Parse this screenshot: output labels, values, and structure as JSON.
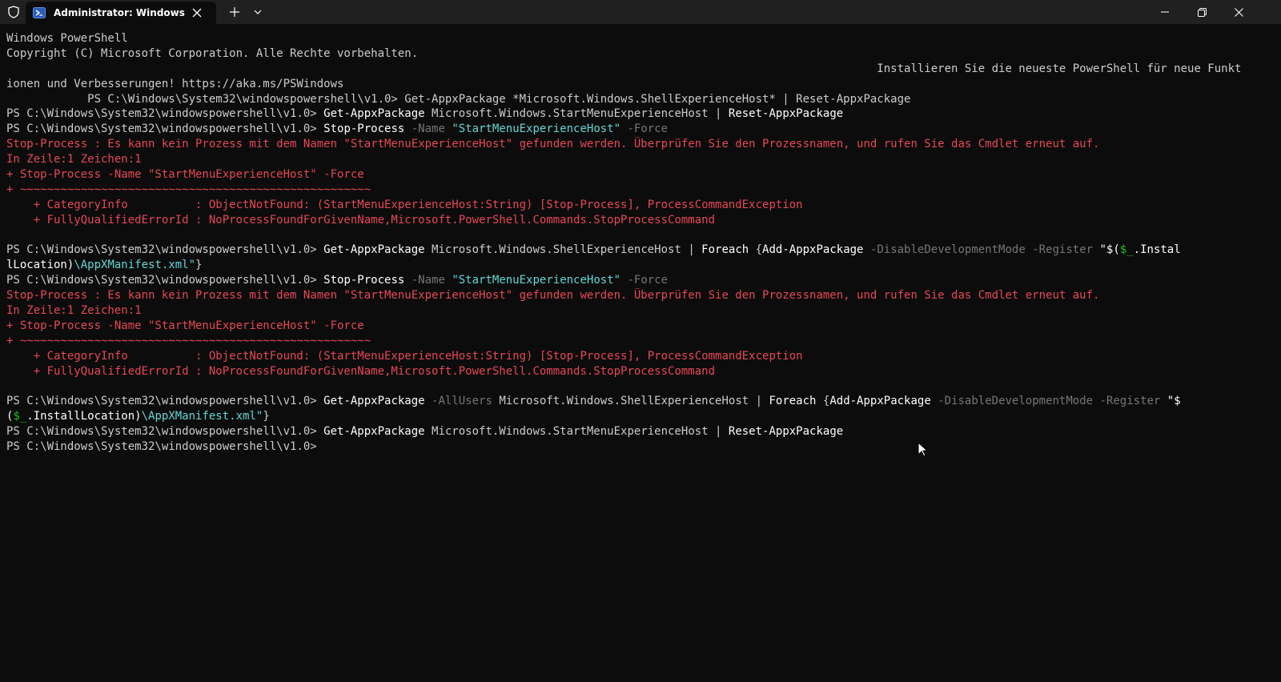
{
  "window": {
    "tab_title": "Administrator: Windows PowerShell",
    "icons": {
      "shield": "shield-icon",
      "tab": "powershell-icon",
      "close": "close-icon",
      "new_tab": "plus-icon",
      "dropdown": "chevron-down-icon",
      "minimize": "minimize-icon",
      "maximize": "restore-icon",
      "close_window": "close-icon"
    }
  },
  "colors": {
    "background": "#0c0c0c",
    "text": "#cccccc",
    "error": "#e74856",
    "string": "#61d6d6",
    "parameter": "#767676",
    "variable": "#16c60c"
  },
  "terminal": {
    "lines": [
      [
        {
          "t": "Windows PowerShell",
          "c": "w"
        }
      ],
      [
        {
          "t": "Copyright (C) Microsoft Corporation. Alle Rechte vorbehalten.",
          "c": "w"
        }
      ],
      [
        {
          "t": "                                                                                                                                 Installieren Sie die neueste PowerShell für neue Funkt",
          "c": "w"
        }
      ],
      [
        {
          "t": "ionen und Verbesserungen! https://aka.ms/PSWindows",
          "c": "w"
        }
      ],
      [
        {
          "t": "            PS C:\\Windows\\System32\\windowspowershell\\v1.0> Get-AppxPackage *Microsoft.Windows.ShellExperienceHost* | Reset-AppxPackage",
          "c": "w"
        }
      ],
      [
        {
          "t": "PS C:\\Windows\\System32\\windowspowershell\\v1.0> ",
          "c": "w"
        },
        {
          "t": "Get-AppxPackage",
          "c": "b"
        },
        {
          "t": " Microsoft.Windows.StartMenuExperienceHost | ",
          "c": "w"
        },
        {
          "t": "Reset-AppxPackage",
          "c": "b"
        }
      ],
      [
        {
          "t": "PS C:\\Windows\\System32\\windowspowershell\\v1.0> ",
          "c": "w"
        },
        {
          "t": "Stop-Process",
          "c": "b"
        },
        {
          "t": " -Name ",
          "c": "g"
        },
        {
          "t": "\"StartMenuExperienceHost\"",
          "c": "bl"
        },
        {
          "t": " -Force",
          "c": "g"
        }
      ],
      [
        {
          "t": "Stop-Process : Es kann kein Prozess mit dem Namen \"StartMenuExperienceHost\" gefunden werden. Überprüfen Sie den Prozessnamen, und rufen Sie das Cmdlet erneut auf.",
          "c": "r"
        }
      ],
      [
        {
          "t": "In Zeile:1 Zeichen:1",
          "c": "r"
        }
      ],
      [
        {
          "t": "+ Stop-Process -Name \"StartMenuExperienceHost\" -Force",
          "c": "r"
        }
      ],
      [
        {
          "t": "+ ~~~~~~~~~~~~~~~~~~~~~~~~~~~~~~~~~~~~~~~~~~~~~~~~~~~~",
          "c": "r"
        }
      ],
      [
        {
          "t": "    + CategoryInfo          : ObjectNotFound: (StartMenuExperienceHost:String) [Stop-Process], ProcessCommandException",
          "c": "r"
        }
      ],
      [
        {
          "t": "    + FullyQualifiedErrorId : NoProcessFoundForGivenName,Microsoft.PowerShell.Commands.StopProcessCommand",
          "c": "r"
        }
      ],
      [
        {
          "t": "",
          "c": "w"
        }
      ],
      [
        {
          "t": "PS C:\\Windows\\System32\\windowspowershell\\v1.0> ",
          "c": "w"
        },
        {
          "t": "Get-AppxPackage",
          "c": "b"
        },
        {
          "t": " Microsoft.Windows.ShellExperienceHost | ",
          "c": "w"
        },
        {
          "t": "Foreach",
          "c": "b"
        },
        {
          "t": " {",
          "c": "w"
        },
        {
          "t": "Add-AppxPackage",
          "c": "b"
        },
        {
          "t": " -DisableDevelopmentMode -Register ",
          "c": "g"
        },
        {
          "t": "\"$(",
          "c": "b"
        },
        {
          "t": "$_",
          "c": "gr"
        },
        {
          "t": ".Instal",
          "c": "b"
        }
      ],
      [
        {
          "t": "lLocation)",
          "c": "b"
        },
        {
          "t": "\\AppXManifest.xml\"",
          "c": "bl"
        },
        {
          "t": "}",
          "c": "w"
        }
      ],
      [
        {
          "t": "PS C:\\Windows\\System32\\windowspowershell\\v1.0> ",
          "c": "w"
        },
        {
          "t": "Stop-Process",
          "c": "b"
        },
        {
          "t": " -Name ",
          "c": "g"
        },
        {
          "t": "\"StartMenuExperienceHost\"",
          "c": "bl"
        },
        {
          "t": " -Force",
          "c": "g"
        }
      ],
      [
        {
          "t": "Stop-Process : Es kann kein Prozess mit dem Namen \"StartMenuExperienceHost\" gefunden werden. Überprüfen Sie den Prozessnamen, und rufen Sie das Cmdlet erneut auf.",
          "c": "r"
        }
      ],
      [
        {
          "t": "In Zeile:1 Zeichen:1",
          "c": "r"
        }
      ],
      [
        {
          "t": "+ Stop-Process -Name \"StartMenuExperienceHost\" -Force",
          "c": "r"
        }
      ],
      [
        {
          "t": "+ ~~~~~~~~~~~~~~~~~~~~~~~~~~~~~~~~~~~~~~~~~~~~~~~~~~~~",
          "c": "r"
        }
      ],
      [
        {
          "t": "    + CategoryInfo          : ObjectNotFound: (StartMenuExperienceHost:String) [Stop-Process], ProcessCommandException",
          "c": "r"
        }
      ],
      [
        {
          "t": "    + FullyQualifiedErrorId : NoProcessFoundForGivenName,Microsoft.PowerShell.Commands.StopProcessCommand",
          "c": "r"
        }
      ],
      [
        {
          "t": "",
          "c": "w"
        }
      ],
      [
        {
          "t": "PS C:\\Windows\\System32\\windowspowershell\\v1.0> ",
          "c": "w"
        },
        {
          "t": "Get-AppxPackage",
          "c": "b"
        },
        {
          "t": " -AllUsers ",
          "c": "g"
        },
        {
          "t": "Microsoft.Windows.ShellExperienceHost | ",
          "c": "w"
        },
        {
          "t": "Foreach",
          "c": "b"
        },
        {
          "t": " {",
          "c": "w"
        },
        {
          "t": "Add-AppxPackage",
          "c": "b"
        },
        {
          "t": " -DisableDevelopmentMode -Register ",
          "c": "g"
        },
        {
          "t": "\"$",
          "c": "b"
        }
      ],
      [
        {
          "t": "(",
          "c": "b"
        },
        {
          "t": "$_",
          "c": "gr"
        },
        {
          "t": ".InstallLocation)",
          "c": "b"
        },
        {
          "t": "\\AppXManifest.xml\"",
          "c": "bl"
        },
        {
          "t": "}",
          "c": "w"
        }
      ],
      [
        {
          "t": "PS C:\\Windows\\System32\\windowspowershell\\v1.0> ",
          "c": "w"
        },
        {
          "t": "Get-AppxPackage",
          "c": "b"
        },
        {
          "t": " Microsoft.Windows.StartMenuExperienceHost | ",
          "c": "w"
        },
        {
          "t": "Reset-AppxPackage",
          "c": "b"
        }
      ],
      [
        {
          "t": "PS C:\\Windows\\System32\\windowspowershell\\v1.0>",
          "c": "w"
        }
      ]
    ]
  }
}
